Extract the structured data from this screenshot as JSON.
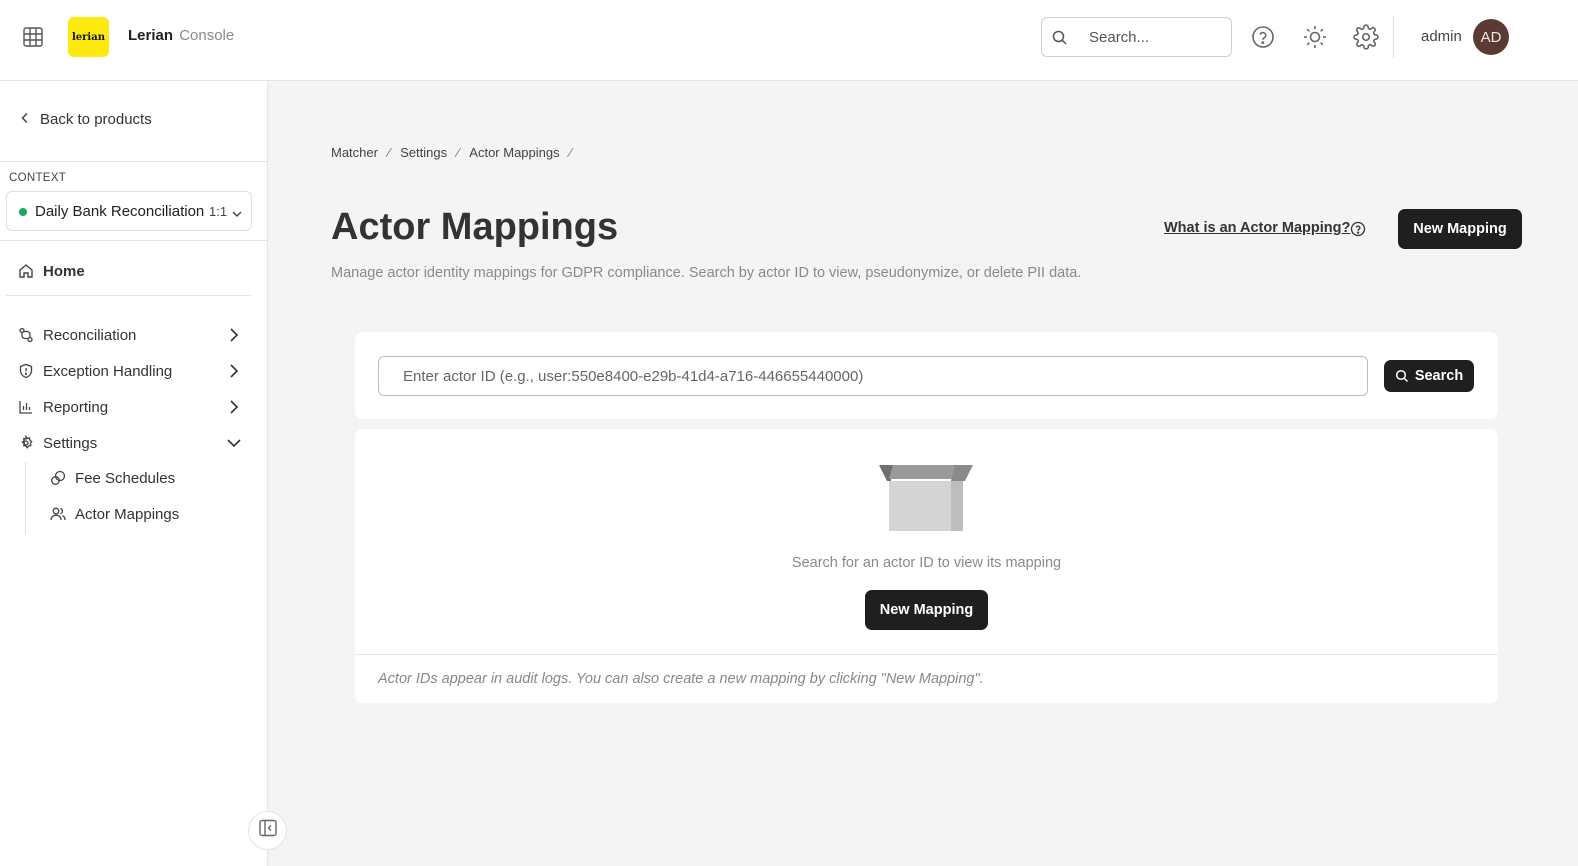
{
  "header": {
    "logo_text": "lerian",
    "brand_name": "Lerian",
    "brand_suffix": "Console",
    "search_placeholder": "Search...",
    "user_name": "admin",
    "avatar_initials": "AD",
    "icons": [
      "apps-grid-icon",
      "search-icon",
      "help-circle-icon",
      "sun-icon",
      "gear-icon"
    ]
  },
  "sidebar": {
    "back_label": "Back to products",
    "context_label": "CONTEXT",
    "context_name": "Daily Bank Reconciliation",
    "context_ratio": "1:1",
    "context_status_color": "#1aa85a",
    "home_label": "Home",
    "items": [
      {
        "label": "Reconciliation",
        "icon": "git-compare-icon",
        "chevron": "right"
      },
      {
        "label": "Exception Handling",
        "icon": "shield-icon",
        "chevron": "right"
      },
      {
        "label": "Reporting",
        "icon": "bar-chart-icon",
        "chevron": "right"
      },
      {
        "label": "Settings",
        "icon": "gear-icon",
        "chevron": "down"
      }
    ],
    "sub_items": [
      {
        "label": "Fee Schedules",
        "icon": "coins-icon"
      },
      {
        "label": "Actor Mappings",
        "icon": "users-icon"
      }
    ]
  },
  "breadcrumb": [
    "Matcher",
    "Settings",
    "Actor Mappings"
  ],
  "page": {
    "title": "Actor Mappings",
    "subtitle": "Manage actor identity mappings for GDPR compliance. Search by actor ID to view, pseudonymize, or delete PII data.",
    "help_link": "What is an Actor Mapping?",
    "new_mapping_label": "New Mapping"
  },
  "search": {
    "placeholder": "Enter actor ID (e.g., user:550e8400-e29b-41d4-a716-446655440000)",
    "button_label": "Search"
  },
  "empty_state": {
    "message": "Search for an actor ID to view its mapping",
    "button_label": "New Mapping",
    "footnote": "Actor IDs appear in audit logs. You can also create a new mapping by clicking \"New Mapping\"."
  }
}
